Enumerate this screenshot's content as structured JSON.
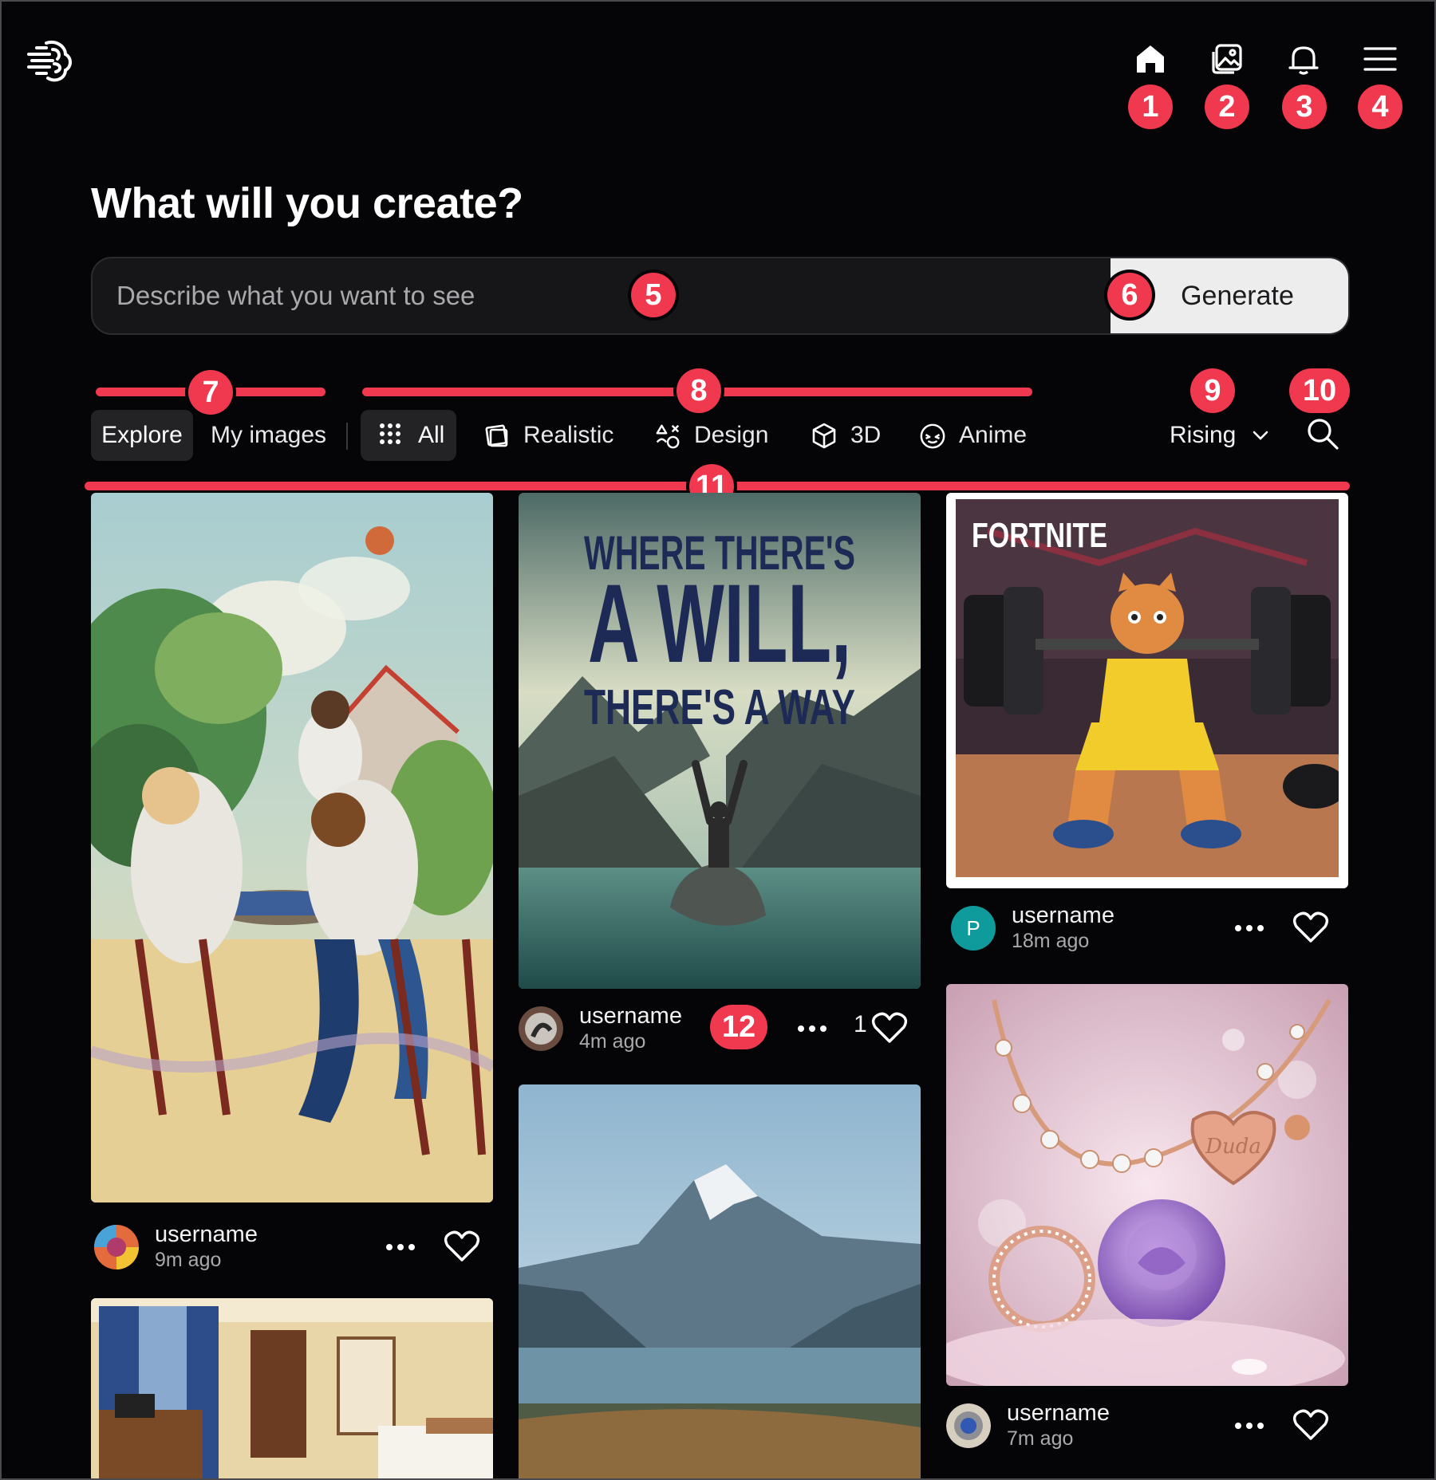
{
  "nav": {
    "items": [
      {
        "name": "home-icon",
        "badge": "1"
      },
      {
        "name": "gallery-icon",
        "badge": "2"
      },
      {
        "name": "bell-icon",
        "badge": "3"
      },
      {
        "name": "menu-icon",
        "badge": "4"
      }
    ]
  },
  "header": {
    "title": "What will you create?",
    "prompt_placeholder": "Describe what you want to see",
    "prompt_value": "",
    "generate_label": "Generate"
  },
  "tabs": {
    "explore": "Explore",
    "my_images": "My images"
  },
  "filters": {
    "all": "All",
    "realistic": "Realistic",
    "design": "Design",
    "three_d": "3D",
    "anime": "Anime"
  },
  "sort": {
    "label": "Rising"
  },
  "annotations": {
    "b5": "5",
    "b6": "6",
    "b7": "7",
    "b8": "8",
    "b9": "9",
    "b10": "10",
    "b11": "11",
    "b12": "12"
  },
  "cards": [
    {
      "username": "username",
      "time": "9m ago",
      "likes": "",
      "image": "painting-chess"
    },
    {
      "username": "username",
      "time": "4m ago",
      "likes": "1",
      "image": "poster-will-way",
      "poster": {
        "line1": "WHERE THERE'S",
        "line2": "A WILL,",
        "line3": "THERE'S A WAY"
      }
    },
    {
      "username": "username",
      "time": "18m ago",
      "likes": "",
      "image": "cat-weightlifting",
      "avatar_letter": "P",
      "brand": "FORTNITE"
    },
    {
      "username": "username",
      "time": "7m ago",
      "likes": "",
      "image": "necklace-rose",
      "engraving": "Duda"
    },
    {
      "username": "",
      "time": "",
      "likes": "",
      "image": "hotel-room"
    },
    {
      "username": "",
      "time": "",
      "likes": "",
      "image": "mountain-lake"
    }
  ],
  "colors": {
    "accent": "#f0384f",
    "background": "#050507",
    "input_bg": "#161618",
    "button_bg": "#ededee",
    "avatar_teal": "#0f9a9c"
  }
}
